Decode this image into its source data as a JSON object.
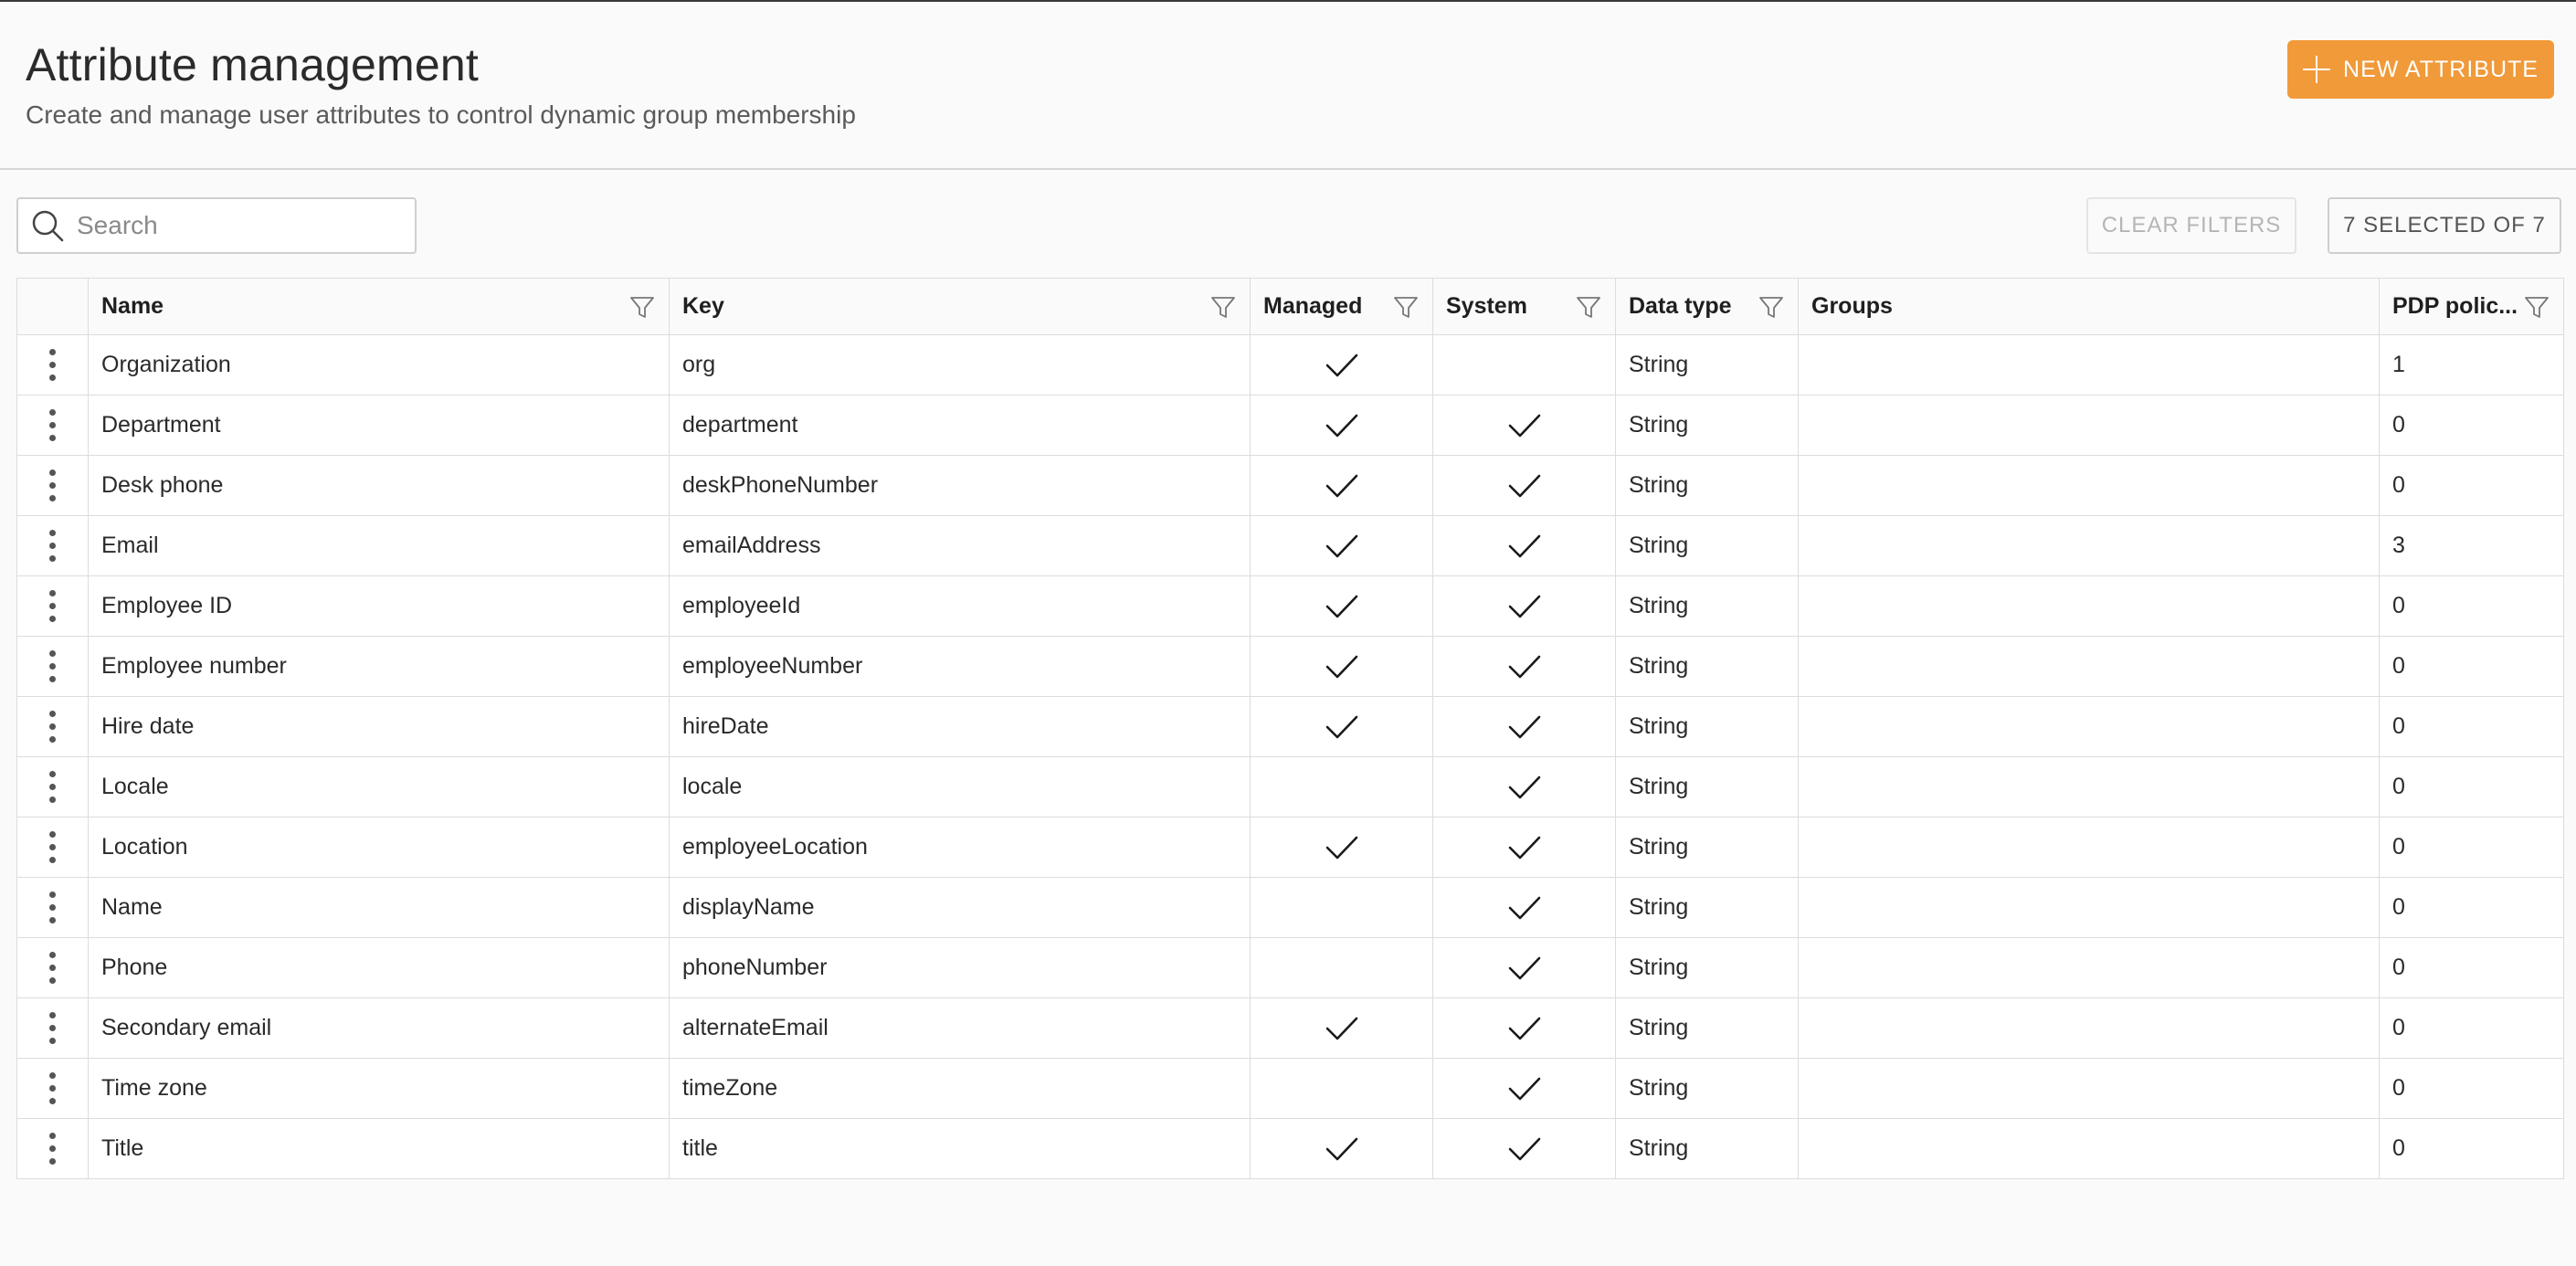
{
  "header": {
    "title": "Attribute management",
    "subtitle": "Create and manage user attributes to control dynamic group membership",
    "new_button_label": "NEW ATTRIBUTE",
    "accent_color": "#f09a3a"
  },
  "toolbar": {
    "search_placeholder": "Search",
    "search_value": "",
    "clear_filters_label": "CLEAR FILTERS",
    "selected_label": "7 SELECTED OF 7"
  },
  "table": {
    "columns": [
      "Name",
      "Key",
      "Managed",
      "System",
      "Data type",
      "Groups",
      "PDP polic..."
    ],
    "rows": [
      {
        "name": "Organization",
        "key": "org",
        "managed": true,
        "system": false,
        "data_type": "String",
        "groups": "",
        "pdp": "1"
      },
      {
        "name": "Department",
        "key": "department",
        "managed": true,
        "system": true,
        "data_type": "String",
        "groups": "",
        "pdp": "0"
      },
      {
        "name": "Desk phone",
        "key": "deskPhoneNumber",
        "managed": true,
        "system": true,
        "data_type": "String",
        "groups": "",
        "pdp": "0"
      },
      {
        "name": "Email",
        "key": "emailAddress",
        "managed": true,
        "system": true,
        "data_type": "String",
        "groups": "",
        "pdp": "3"
      },
      {
        "name": "Employee ID",
        "key": "employeeId",
        "managed": true,
        "system": true,
        "data_type": "String",
        "groups": "",
        "pdp": "0"
      },
      {
        "name": "Employee number",
        "key": "employeeNumber",
        "managed": true,
        "system": true,
        "data_type": "String",
        "groups": "",
        "pdp": "0"
      },
      {
        "name": "Hire date",
        "key": "hireDate",
        "managed": true,
        "system": true,
        "data_type": "String",
        "groups": "",
        "pdp": "0"
      },
      {
        "name": "Locale",
        "key": "locale",
        "managed": false,
        "system": true,
        "data_type": "String",
        "groups": "",
        "pdp": "0"
      },
      {
        "name": "Location",
        "key": "employeeLocation",
        "managed": true,
        "system": true,
        "data_type": "String",
        "groups": "",
        "pdp": "0"
      },
      {
        "name": "Name",
        "key": "displayName",
        "managed": false,
        "system": true,
        "data_type": "String",
        "groups": "",
        "pdp": "0"
      },
      {
        "name": "Phone",
        "key": "phoneNumber",
        "managed": false,
        "system": true,
        "data_type": "String",
        "groups": "",
        "pdp": "0"
      },
      {
        "name": "Secondary email",
        "key": "alternateEmail",
        "managed": true,
        "system": true,
        "data_type": "String",
        "groups": "",
        "pdp": "0"
      },
      {
        "name": "Time zone",
        "key": "timeZone",
        "managed": false,
        "system": true,
        "data_type": "String",
        "groups": "",
        "pdp": "0"
      },
      {
        "name": "Title",
        "key": "title",
        "managed": true,
        "system": true,
        "data_type": "String",
        "groups": "",
        "pdp": "0"
      }
    ]
  },
  "icons": {
    "row_menu": "kebab-icon",
    "filter": "filter-icon",
    "check": "check-icon",
    "search": "search-icon",
    "add": "plus-icon"
  }
}
